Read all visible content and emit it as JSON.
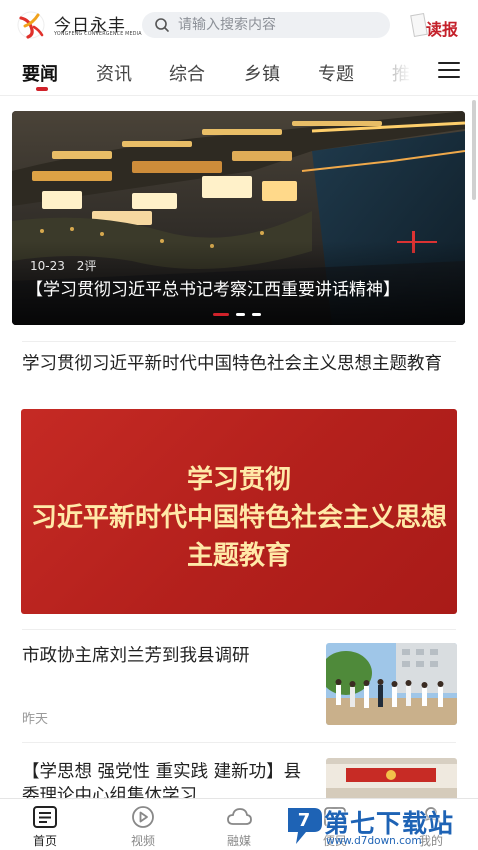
{
  "header": {
    "logo_title": "今日永丰",
    "logo_subtitle": "YONGFENG CONVERGENCE MEDIA",
    "search_placeholder": "请输入搜索内容",
    "read_paper_label": "读报"
  },
  "tabs": [
    {
      "label": "要闻",
      "active": true
    },
    {
      "label": "资讯",
      "active": false
    },
    {
      "label": "综合",
      "active": false
    },
    {
      "label": "乡镇",
      "active": false
    },
    {
      "label": "专题",
      "active": false
    },
    {
      "label": "推",
      "active": false
    }
  ],
  "banner": {
    "date": "10-23",
    "comments": "2评",
    "title": "【学习贯彻习近平总书记考察江西重要讲话精神】",
    "slide_count": 3,
    "active_slide": 1
  },
  "articles": [
    {
      "title": "学习贯彻习近平新时代中国特色社会主义思想主题教育",
      "image_lines": [
        "学习贯彻",
        "习近平新时代中国特色社会主义思想",
        "主题教育"
      ]
    },
    {
      "title": "市政协主席刘兰芳到我县调研",
      "time": "昨天",
      "thumb_icon": "group-photo-thumbnail"
    },
    {
      "title": "【学思想 强党性 重实践 建新功】县委理论中心组集体学习",
      "thumb_icon": "meeting-room-thumbnail"
    }
  ],
  "bottom_nav": [
    {
      "label": "首页",
      "icon": "home-icon",
      "active": true
    },
    {
      "label": "视频",
      "icon": "play-icon",
      "active": false
    },
    {
      "label": "融媒",
      "icon": "cloud-icon",
      "active": false
    },
    {
      "label": "便民",
      "icon": "service-icon",
      "active": false
    },
    {
      "label": "我的",
      "icon": "user-icon",
      "active": false
    }
  ],
  "watermark": {
    "title": "第七下载站",
    "url": "www.d7down.com"
  },
  "colors": {
    "brand_red": "#d0222a",
    "banner_title": "#ffffff",
    "watermark_blue": "#1e63b5"
  }
}
